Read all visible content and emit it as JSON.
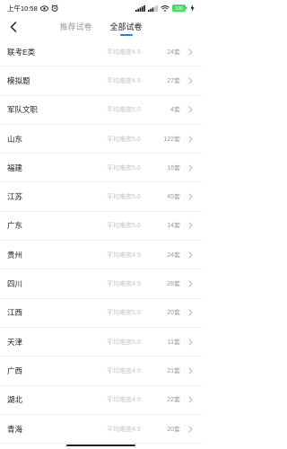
{
  "status_bar": {
    "time": "上午10:58",
    "battery": "100"
  },
  "nav": {
    "tabs": [
      {
        "label": "推荐试卷",
        "active": false
      },
      {
        "label": "全部试卷",
        "active": true
      }
    ]
  },
  "colors": {
    "accent": "#2b7cf6",
    "battery": "#4cd964"
  },
  "papers": [
    {
      "name": "联考E类",
      "rating": "平均难度4.9",
      "count": "24套"
    },
    {
      "name": "模拟题",
      "rating": "平均难度4.9",
      "count": "27套"
    },
    {
      "name": "军队文职",
      "rating": "平均难度5.0",
      "count": "4套"
    },
    {
      "name": "山东",
      "rating": "平均难度5.0",
      "count": "122套"
    },
    {
      "name": "福建",
      "rating": "平均难度5.0",
      "count": "16套"
    },
    {
      "name": "江苏",
      "rating": "平均难度5.0",
      "count": "45套"
    },
    {
      "name": "广东",
      "rating": "平均难度5.0",
      "count": "14套"
    },
    {
      "name": "贵州",
      "rating": "平均难度4.9",
      "count": "24套"
    },
    {
      "name": "四川",
      "rating": "平均难度4.9",
      "count": "28套"
    },
    {
      "name": "江西",
      "rating": "平均难度5.0",
      "count": "20套"
    },
    {
      "name": "天津",
      "rating": "平均难度5.0",
      "count": "11套"
    },
    {
      "name": "广西",
      "rating": "平均难度4.9",
      "count": "21套"
    },
    {
      "name": "湖北",
      "rating": "平均难度4.9",
      "count": "22套"
    },
    {
      "name": "青海",
      "rating": "平均难度4.9",
      "count": "20套"
    }
  ]
}
